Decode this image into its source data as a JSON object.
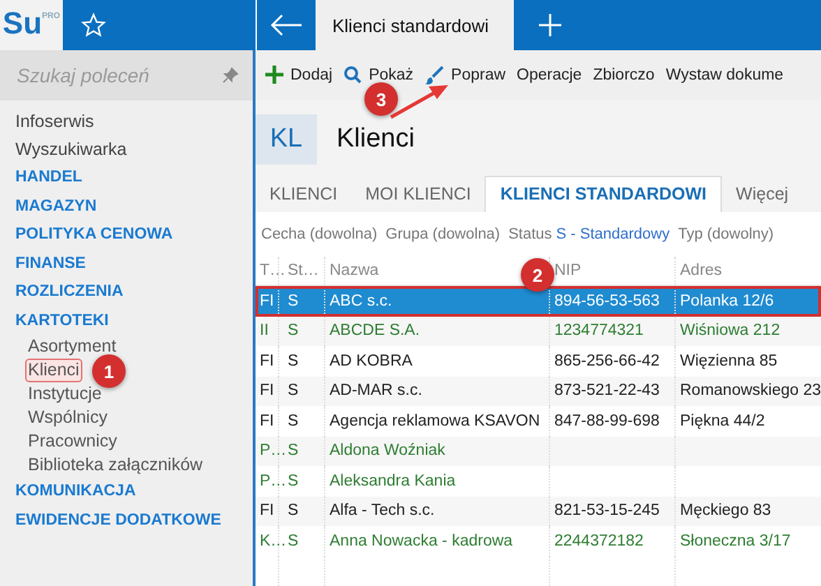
{
  "app": {
    "logo": "Su",
    "logo_badge": "PRO"
  },
  "top_tabs": [
    {
      "label": "Klienci standardowi",
      "selected": true
    }
  ],
  "sidebar": {
    "search": {
      "placeholder": "Szukaj poleceń"
    },
    "items": [
      {
        "label": "Infoserwis",
        "kind": "link",
        "highlighted": false
      },
      {
        "label": "Wyszukiwarka",
        "kind": "link",
        "highlighted": false
      },
      {
        "label": "HANDEL",
        "kind": "section",
        "highlighted": false
      },
      {
        "label": "MAGAZYN",
        "kind": "section",
        "highlighted": false
      },
      {
        "label": "POLITYKA CENOWA",
        "kind": "section",
        "highlighted": false
      },
      {
        "label": "FINANSE",
        "kind": "section",
        "highlighted": false
      },
      {
        "label": "ROZLICZENIA",
        "kind": "section",
        "highlighted": false
      },
      {
        "label": "KARTOTEKI",
        "kind": "section",
        "highlighted": false,
        "children": [
          {
            "label": "Asortyment",
            "kind": "link",
            "highlighted": false
          },
          {
            "label": "Klienci",
            "kind": "link",
            "highlighted": true
          },
          {
            "label": "Instytucje",
            "kind": "link",
            "highlighted": false
          },
          {
            "label": "Wspólnicy",
            "kind": "link",
            "highlighted": false
          },
          {
            "label": "Pracownicy",
            "kind": "link",
            "highlighted": false
          },
          {
            "label": "Biblioteka załączników",
            "kind": "link",
            "highlighted": false
          }
        ]
      },
      {
        "label": "KOMUNIKACJA",
        "kind": "section",
        "highlighted": false
      },
      {
        "label": "EWIDENCJE DODATKOWE",
        "kind": "section",
        "highlighted": false
      }
    ]
  },
  "toolbar": [
    {
      "label": "Dodaj",
      "kind": "plus"
    },
    {
      "label": "Pokaż",
      "kind": "search"
    },
    {
      "label": "Popraw",
      "kind": "brush"
    },
    {
      "label": "Operacje",
      "kind": "text"
    },
    {
      "label": "Zbiorczo",
      "kind": "text"
    },
    {
      "label": "Wystaw dokume",
      "kind": "text"
    }
  ],
  "header": {
    "badge": "KL",
    "title": "Klienci"
  },
  "tabs": [
    {
      "label": "KLIENCI",
      "selected": false
    },
    {
      "label": "MOI KLIENCI",
      "selected": false
    },
    {
      "label": "KLIENCI STANDARDOWI",
      "selected": true
    },
    {
      "label": "Więcej",
      "selected": false
    }
  ],
  "filters": [
    {
      "label": "Cecha (dowolna)"
    },
    {
      "label": "Grupa (dowolna)"
    },
    {
      "label": "Status",
      "value": "S - Standardowy"
    },
    {
      "label": "Typ (dowolny)"
    }
  ],
  "table": {
    "columns": [
      "T…",
      "St…",
      "Nazwa",
      "NIP",
      "Adres"
    ],
    "rows": [
      {
        "cells": [
          "FI",
          "S",
          "ABC s.c.",
          "894-56-53-563",
          "Polanka  12/6"
        ],
        "selected": true,
        "highlighted": true
      },
      {
        "cells": [
          "II",
          "S",
          "ABCDE S.A.",
          "1234774321",
          "Wiśniowa 212"
        ],
        "color": "#2e7d32",
        "selected": false,
        "highlighted": false
      },
      {
        "cells": [
          "FI",
          "S",
          "AD KOBRA",
          "865-256-66-42",
          "Więzienna  85"
        ],
        "color": "#222222",
        "selected": false,
        "highlighted": false
      },
      {
        "cells": [
          "FI",
          "S",
          "AD-MAR s.c.",
          "873-521-22-43",
          "Romanowskiego 23"
        ],
        "color": "#222222",
        "selected": false,
        "highlighted": false
      },
      {
        "cells": [
          "FI",
          "S",
          "Agencja reklamowa KSAVON",
          "847-88-99-698",
          "Piękna  44/2"
        ],
        "color": "#222222",
        "selected": false,
        "highlighted": false
      },
      {
        "cells": [
          "P…",
          "S",
          "Aldona Woźniak",
          "",
          ""
        ],
        "color": "#2e7d32",
        "selected": false,
        "highlighted": false
      },
      {
        "cells": [
          "P…",
          "S",
          "Aleksandra Kania",
          "",
          ""
        ],
        "color": "#2e7d32",
        "selected": false,
        "highlighted": false
      },
      {
        "cells": [
          "FI",
          "S",
          "Alfa - Tech s.c.",
          "821-53-15-245",
          "Męckiego  83"
        ],
        "color": "#222222",
        "selected": false,
        "highlighted": false
      },
      {
        "cells": [
          "K…",
          "S",
          "Anna Nowacka - kadrowa",
          "2244372182",
          "Słoneczna 3/17"
        ],
        "color": "#2e7d32",
        "selected": false,
        "highlighted": false
      }
    ]
  },
  "callouts": [
    {
      "label": "1",
      "kind": "badge"
    },
    {
      "label": "2",
      "kind": "badge"
    },
    {
      "label": "3",
      "kind": "arrowed"
    }
  ]
}
